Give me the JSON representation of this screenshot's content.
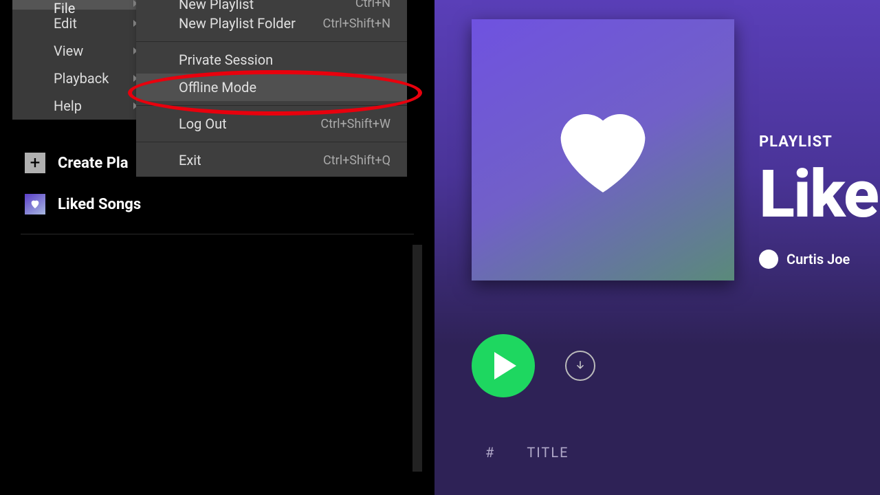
{
  "menubar": {
    "items": [
      {
        "label": "File",
        "active": true
      },
      {
        "label": "Edit"
      },
      {
        "label": "View"
      },
      {
        "label": "Playback"
      },
      {
        "label": "Help"
      }
    ]
  },
  "submenu": {
    "items": [
      {
        "label": "New Playlist",
        "shortcut": "Ctrl+N"
      },
      {
        "label": "New Playlist Folder",
        "shortcut": "Ctrl+Shift+N"
      },
      {
        "separator": true
      },
      {
        "label": "Private Session"
      },
      {
        "label": "Offline Mode",
        "highlighted": true
      },
      {
        "separator": true
      },
      {
        "label": "Log Out",
        "shortcut": "Ctrl+Shift+W"
      },
      {
        "separator": true
      },
      {
        "label": "Exit",
        "shortcut": "Ctrl+Shift+Q"
      }
    ]
  },
  "sidebar": {
    "create_label": "Create Pla",
    "liked_label": "Liked Songs"
  },
  "playlist": {
    "tag": "PLAYLIST",
    "title": "Like",
    "owner": "Curtis Joe"
  },
  "list_header": {
    "col_num": "#",
    "col_title": "TITLE"
  }
}
